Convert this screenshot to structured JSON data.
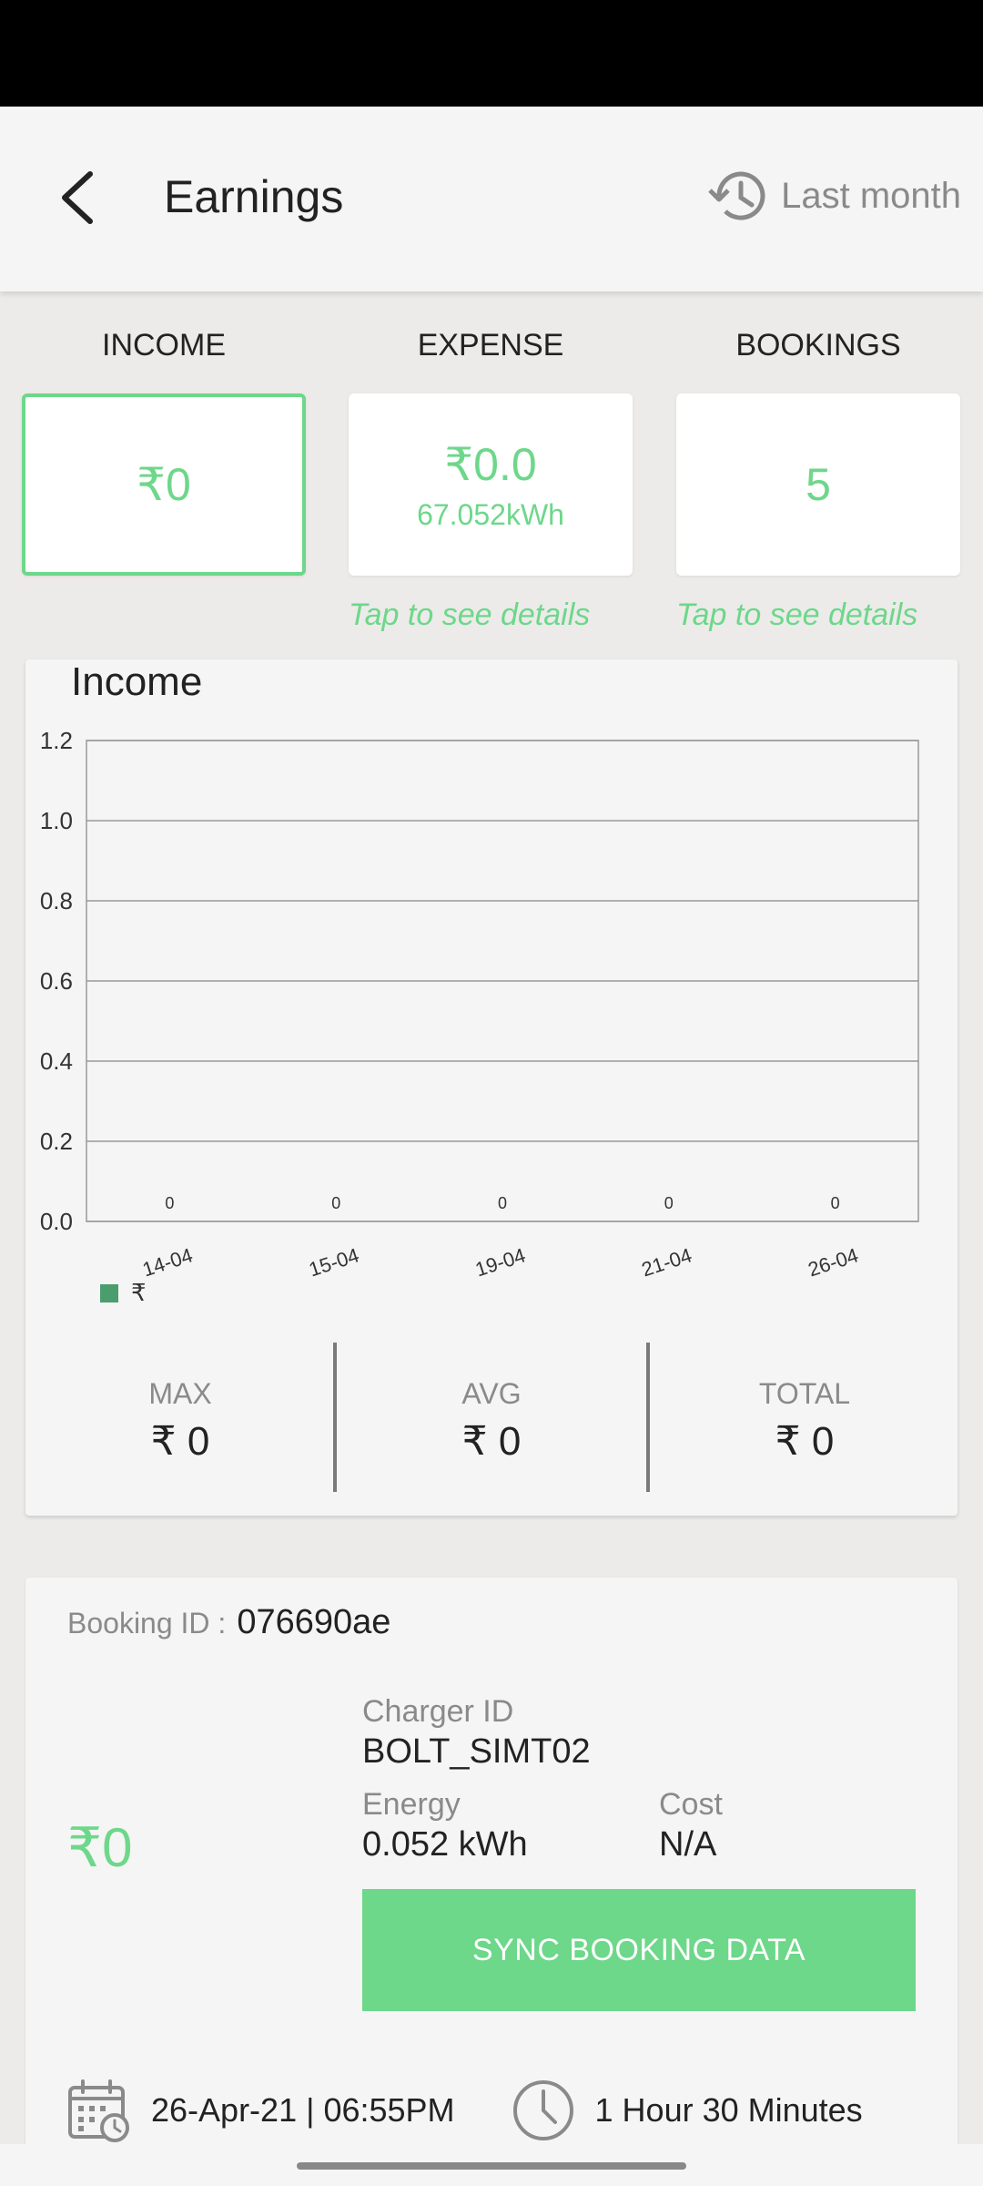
{
  "header": {
    "title": "Earnings",
    "period_label": "Last month"
  },
  "summary": {
    "income": {
      "heading": "INCOME",
      "value": "₹0"
    },
    "expense": {
      "heading": "EXPENSE",
      "value": "₹0.0",
      "sub_value": "67.052kWh",
      "hint": "Tap to see details"
    },
    "bookings": {
      "heading": "BOOKINGS",
      "value": "5",
      "hint": "Tap to see details"
    }
  },
  "chart_data": {
    "type": "bar",
    "title": "Income",
    "categories": [
      "14-04",
      "15-04",
      "19-04",
      "21-04",
      "26-04"
    ],
    "series": [
      {
        "name": "₹",
        "values": [
          0,
          0,
          0,
          0,
          0
        ]
      }
    ],
    "value_labels": [
      "0",
      "0",
      "0",
      "0",
      "0"
    ],
    "ylim": [
      0,
      1.2
    ],
    "yticks": [
      "0.0",
      "0.2",
      "0.4",
      "0.6",
      "0.8",
      "1.0",
      "1.2"
    ],
    "grid": true,
    "legend": "bottom-left",
    "color": "#4A9E6E"
  },
  "stats": {
    "max": {
      "label": "MAX",
      "value": "₹ 0"
    },
    "avg": {
      "label": "AVG",
      "value": "₹ 0"
    },
    "total": {
      "label": "TOTAL",
      "value": "₹ 0"
    }
  },
  "booking": {
    "id_label": "Booking ID :",
    "id": "076690ae",
    "amount": "₹0",
    "charger_id_label": "Charger ID",
    "charger_id": "BOLT_SIMT02",
    "energy_label": "Energy",
    "energy": "0.052 kWh",
    "cost_label": "Cost",
    "cost": "N/A",
    "sync_label": "SYNC BOOKING DATA",
    "datetime": "26-Apr-21 | 06:55PM",
    "duration": "1 Hour 30 Minutes"
  },
  "colors": {
    "accent": "#6DD78A",
    "bar": "#4A9E6E"
  },
  "icons": [
    "back-arrow-icon",
    "history-icon",
    "calendar-clock-icon",
    "clock-icon"
  ]
}
